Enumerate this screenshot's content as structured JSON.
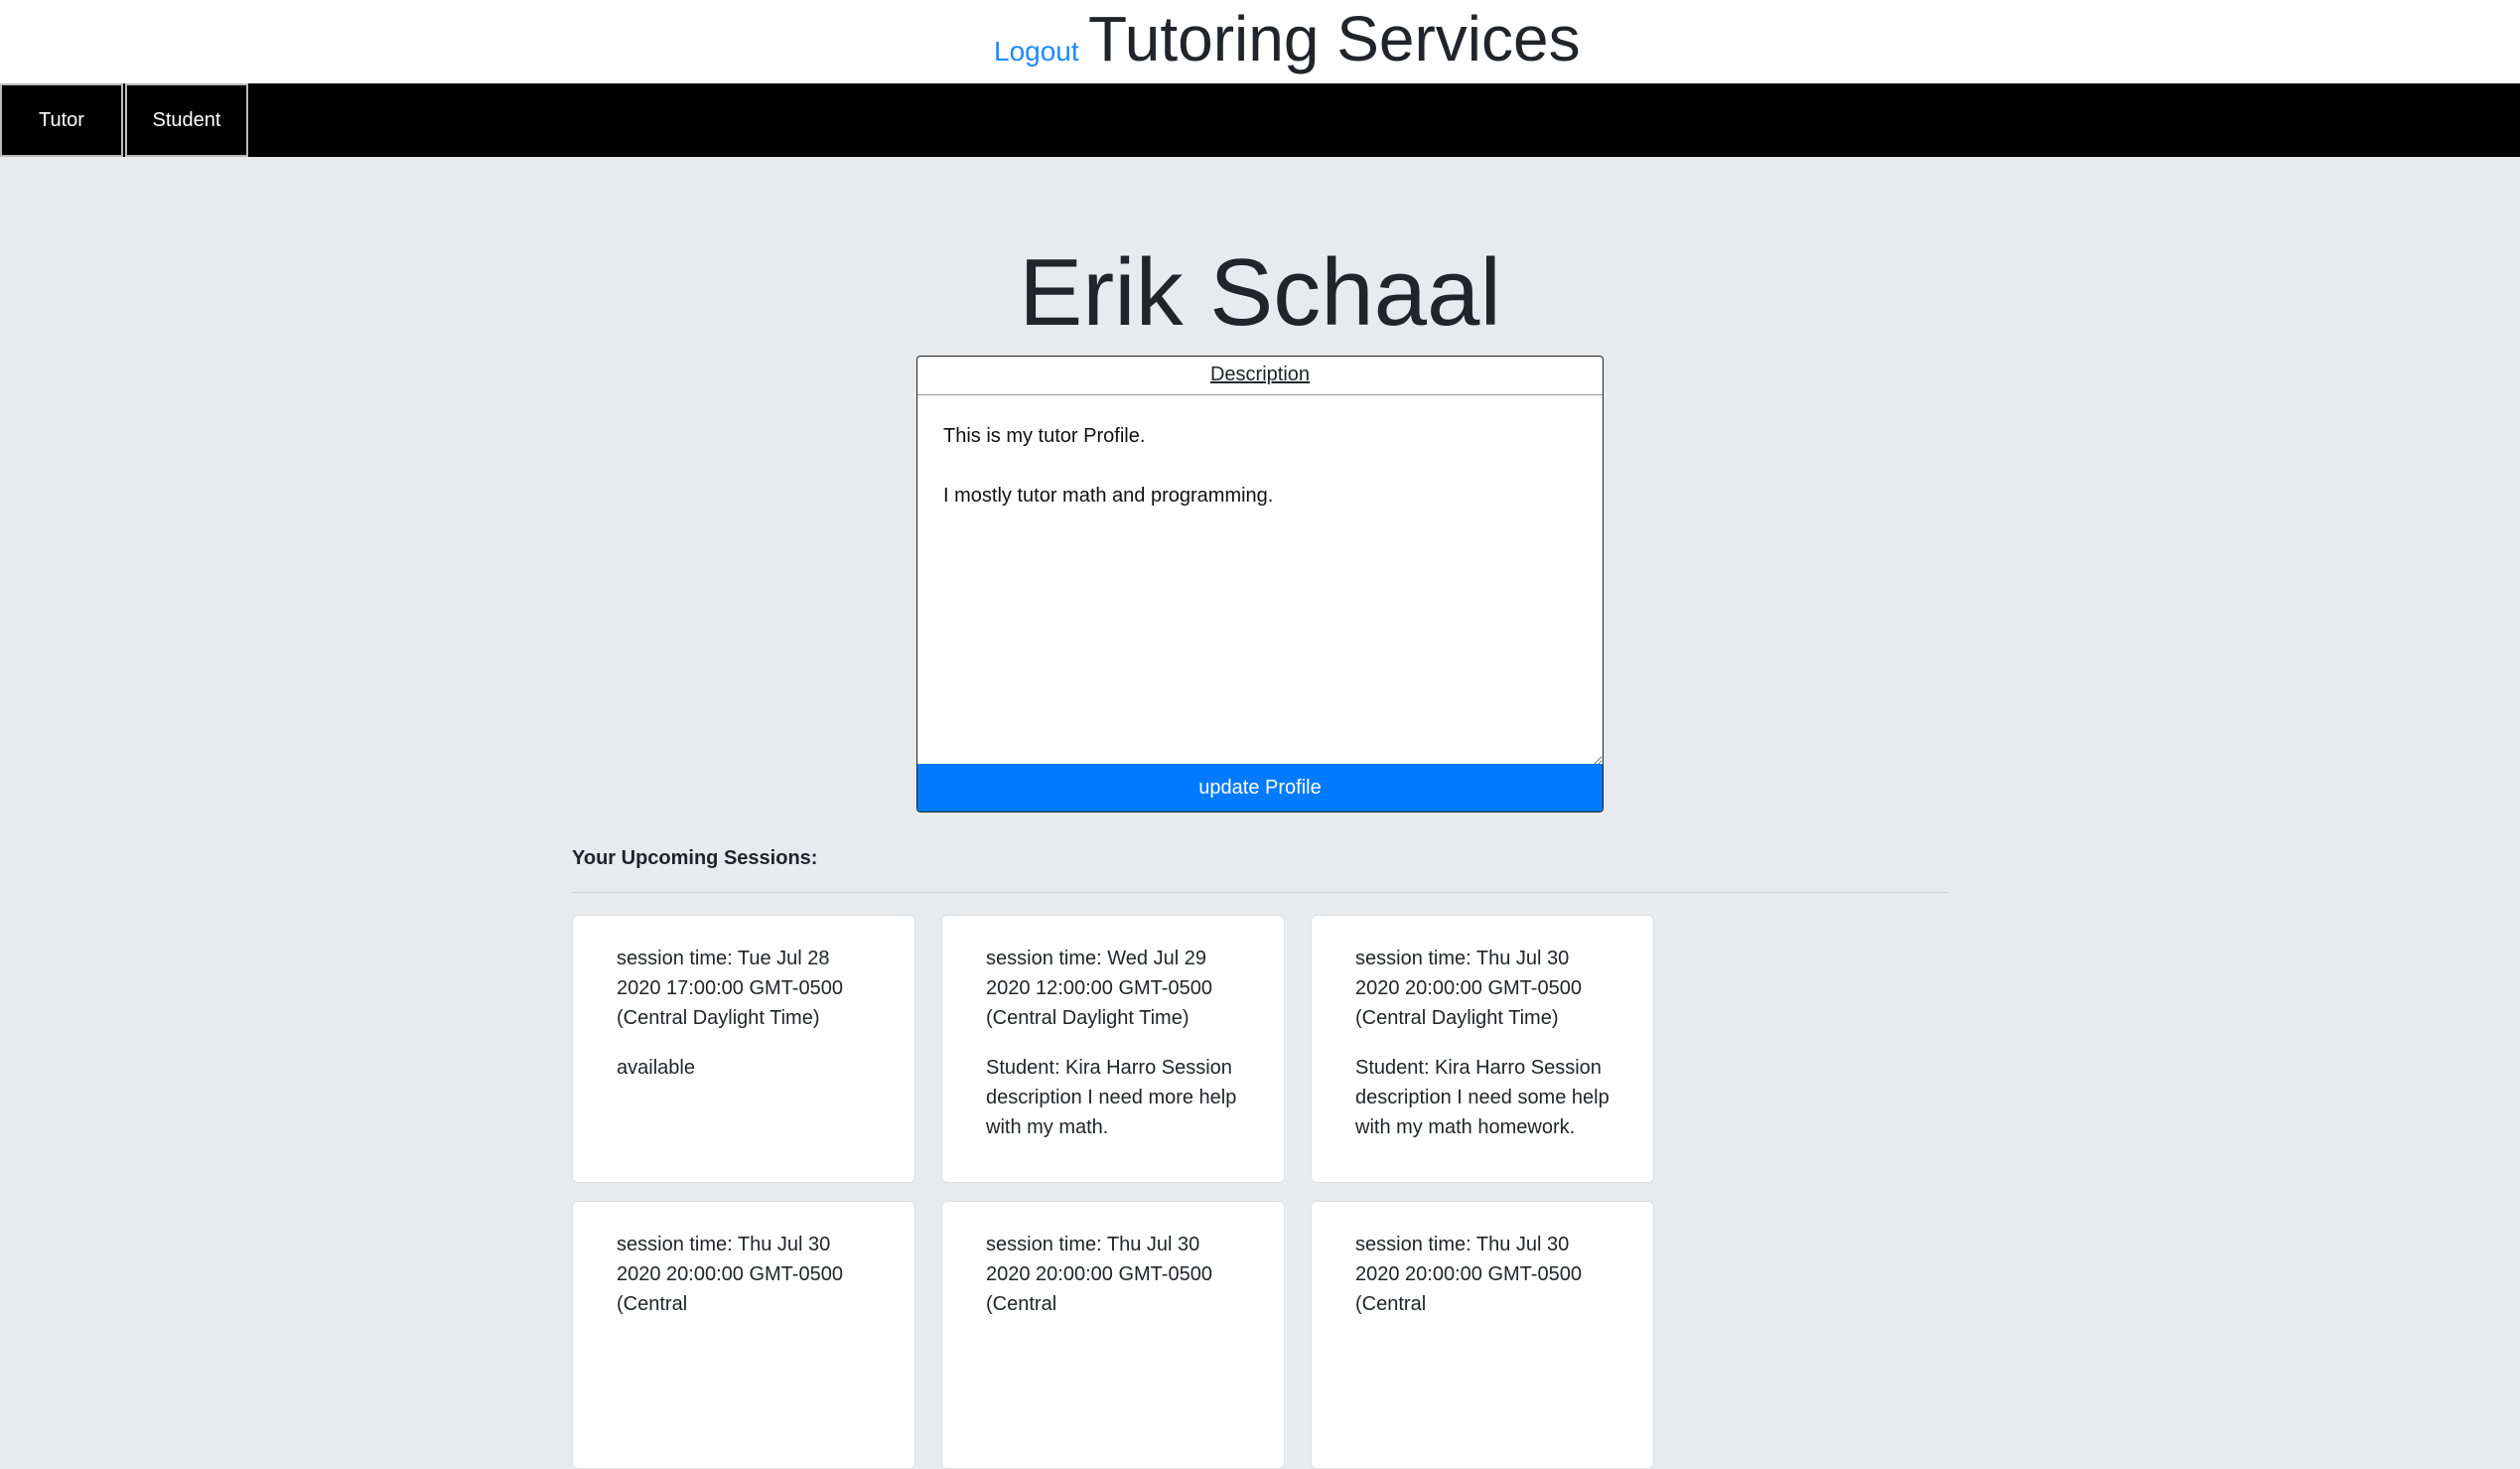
{
  "header": {
    "logout": "Logout",
    "title": "Tutoring Services"
  },
  "nav": {
    "tutor": "Tutor",
    "student": "Student"
  },
  "profile": {
    "name": "Erik Schaal",
    "description_label": "Description",
    "description_text": "This is my tutor Profile.\n\nI mostly tutor math and programming.",
    "update_label": "update Profile"
  },
  "sessions": {
    "heading": "Your Upcoming Sessions:",
    "items": [
      {
        "time": "session time: Tue Jul 28 2020 17:00:00 GMT-0500 (Central Daylight Time)",
        "detail": "available"
      },
      {
        "time": "session time: Wed Jul 29 2020 12:00:00 GMT-0500 (Central Daylight Time)",
        "detail": "Student: Kira Harro Session description I need more help with my math."
      },
      {
        "time": "session time: Thu Jul 30 2020 20:00:00 GMT-0500 (Central Daylight Time)",
        "detail": "Student: Kira Harro Session description I need some help with my math homework."
      },
      {
        "time": "session time: Thu Jul 30 2020 20:00:00 GMT-0500 (Central",
        "detail": ""
      },
      {
        "time": "session time: Thu Jul 30 2020 20:00:00 GMT-0500 (Central",
        "detail": ""
      },
      {
        "time": "session time: Thu Jul 30 2020 20:00:00 GMT-0500 (Central",
        "detail": ""
      }
    ]
  }
}
